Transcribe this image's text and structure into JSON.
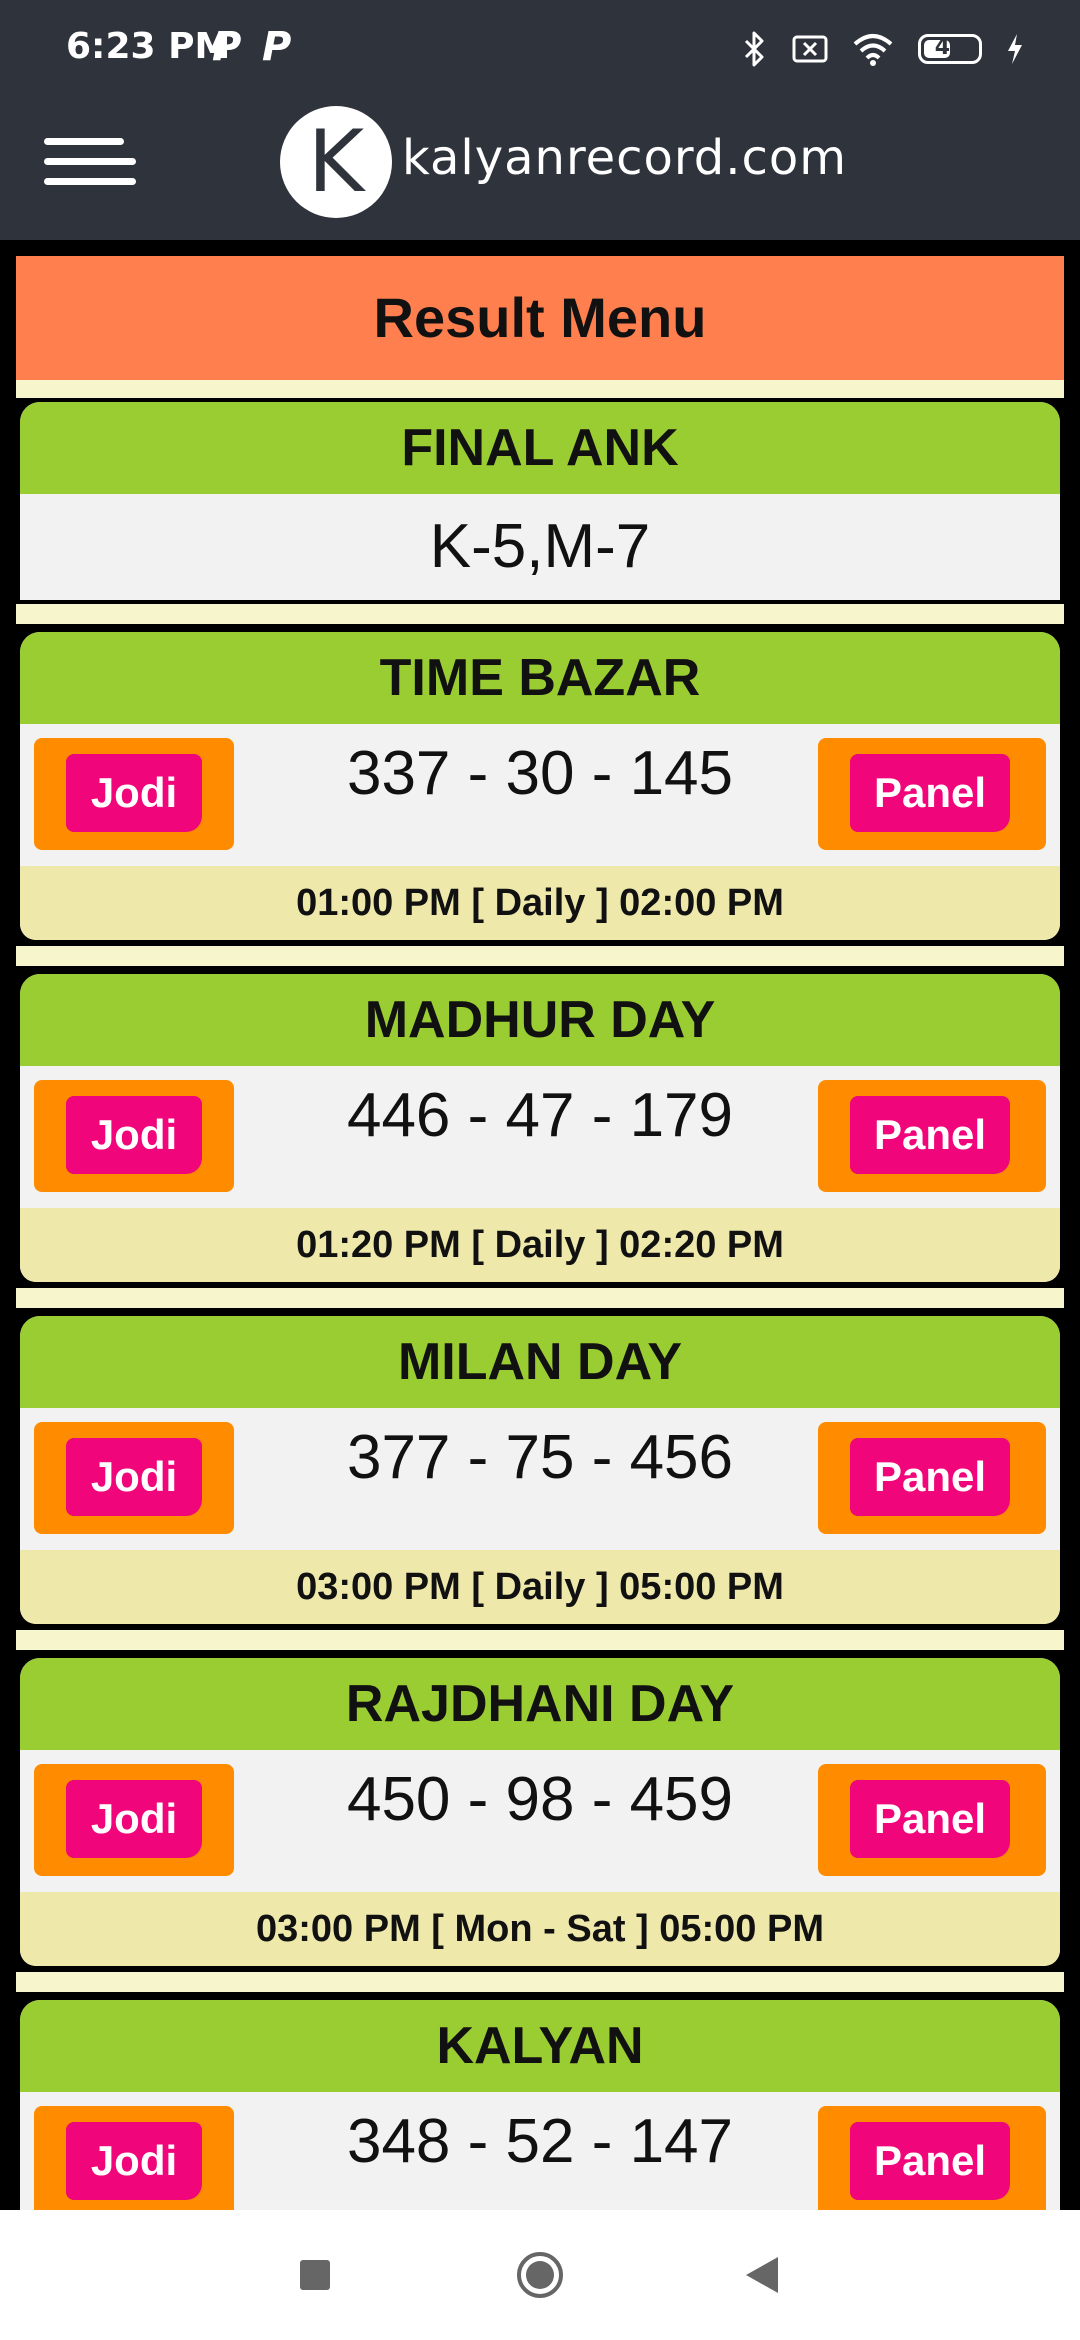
{
  "status_bar": {
    "time": "6:23 PM",
    "notif_icons": [
      "P",
      "P"
    ],
    "battery": "47"
  },
  "header": {
    "logo_letter": "K",
    "site_name": "kalyanrecord.com"
  },
  "result_menu": {
    "title": "Result Menu"
  },
  "final_ank": {
    "title": "FINAL ANK",
    "value": "K-5,M-7"
  },
  "buttons": {
    "jodi": "Jodi",
    "panel": "Panel"
  },
  "markets": [
    {
      "name": "TIME BAZAR",
      "result": "337 - 30 - 145",
      "timing": "01:00 PM [ Daily ] 02:00 PM"
    },
    {
      "name": "MADHUR DAY",
      "result": "446 - 47 - 179",
      "timing": "01:20 PM [ Daily ] 02:20 PM"
    },
    {
      "name": "MILAN DAY",
      "result": "377 - 75 - 456",
      "timing": "03:00 PM [ Daily ] 05:00 PM"
    },
    {
      "name": "RAJDHANI DAY",
      "result": "450 - 98 - 459",
      "timing": "03:00 PM [ Mon - Sat ] 05:00 PM"
    },
    {
      "name": "KALYAN",
      "result": "348 - 52 - 147",
      "timing": ""
    }
  ],
  "colors": {
    "header_bg": "#2f333b",
    "result_menu_bg": "#ff7f4f",
    "card_head_bg": "#9acd32",
    "card_foot_bg": "#eee8aa",
    "button_outer": "#ff8c00",
    "button_inner": "#f0057a"
  }
}
